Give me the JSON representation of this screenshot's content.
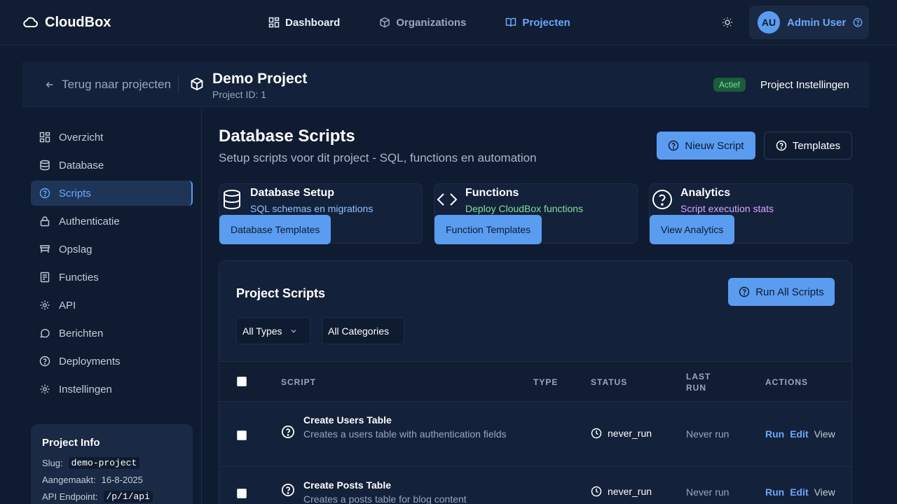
{
  "brand": {
    "name": "CloudBox"
  },
  "nav": {
    "dashboard": "Dashboard",
    "organizations": "Organizations",
    "projects": "Projecten"
  },
  "user": {
    "initials": "AU",
    "name": "Admin User"
  },
  "project": {
    "back_label": "Terug naar projecten",
    "title": "Demo Project",
    "id_label": "Project ID: 1",
    "status": "Actief",
    "settings_label": "Project Instellingen"
  },
  "sidebar": {
    "items": [
      {
        "label": "Overzicht",
        "icon": "grid-icon"
      },
      {
        "label": "Database",
        "icon": "database-icon"
      },
      {
        "label": "Scripts",
        "icon": "help-circle-icon"
      },
      {
        "label": "Authenticatie",
        "icon": "lock-icon"
      },
      {
        "label": "Opslag",
        "icon": "storage-icon"
      },
      {
        "label": "Functies",
        "icon": "code-file-icon"
      },
      {
        "label": "API",
        "icon": "gear-icon"
      },
      {
        "label": "Berichten",
        "icon": "chat-icon"
      },
      {
        "label": "Deployments",
        "icon": "help-circle-icon"
      },
      {
        "label": "Instellingen",
        "icon": "gear-icon"
      }
    ],
    "project_info": {
      "title": "Project Info",
      "slug_label": "Slug:",
      "slug": "demo-project",
      "created_label": "Aangemaakt:",
      "created": "16-8-2025",
      "endpoint_label": "API Endpoint:",
      "endpoint": "/p/1/api"
    }
  },
  "main": {
    "title": "Database Scripts",
    "subtitle": "Setup scripts voor dit project - SQL, functions en automation",
    "new_script": "Nieuw Script",
    "templates": "Templates",
    "features": [
      {
        "title": "Database Setup",
        "subtitle": "SQL schemas en migrations",
        "button": "Database Templates",
        "color": "#8ec5ff"
      },
      {
        "title": "Functions",
        "subtitle": "Deploy CloudBox functions",
        "button": "Function Templates",
        "color": "#7ee3a0"
      },
      {
        "title": "Analytics",
        "subtitle": "Script execution stats",
        "button": "View Analytics",
        "color": "#d7a6ff"
      }
    ],
    "scripts": {
      "title": "Project Scripts",
      "run_all": "Run All Scripts",
      "filter_types": "All Types",
      "filter_categories": "All Categories",
      "columns": {
        "script": "SCRIPT",
        "type": "TYPE",
        "status": "STATUS",
        "last_run_1": "LAST",
        "last_run_2": "RUN",
        "actions": "ACTIONS"
      },
      "rows": [
        {
          "name": "Create Users Table",
          "description": "Creates a users table with authentication fields",
          "status": "never_run",
          "last_run": "Never run",
          "run": "Run",
          "edit": "Edit",
          "view": "View"
        },
        {
          "name": "Create Posts Table",
          "description": "Creates a posts table for blog content",
          "status": "never_run",
          "last_run": "Never run",
          "run": "Run",
          "edit": "Edit",
          "view": "View"
        }
      ]
    }
  }
}
